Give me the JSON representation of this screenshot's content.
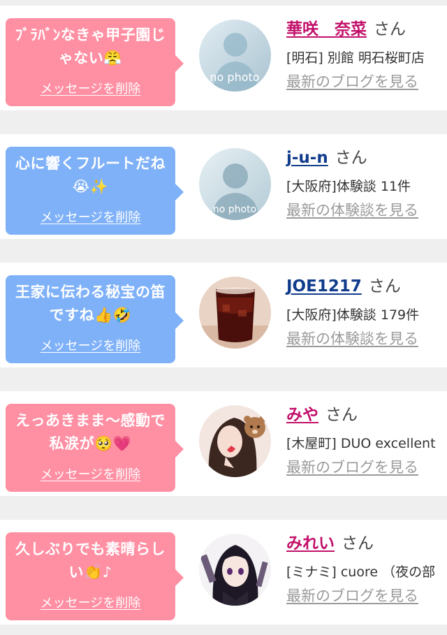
{
  "messages": [
    {
      "text": "ﾌﾞﾗﾊﾞﾝなきゃ甲子園じゃない😤",
      "delete_label": "メッセージを削除",
      "bubble_color": "#ff8fa3",
      "avatar": "no-photo-placeholder",
      "avatar_text": "no photo",
      "user_name": "華咲　奈菜",
      "name_color": "#c2106a",
      "honorific": "さん",
      "meta": "[明石] 別館 明石桜町店",
      "link_label": "最新のブログを見る"
    },
    {
      "text": "心に響くフルートだね😭✨",
      "delete_label": "メッセージを削除",
      "bubble_color": "#7fb1f8",
      "avatar": "no-photo-placeholder",
      "avatar_text": "no photo",
      "user_name": "j-u-n",
      "name_color": "#103c8c",
      "honorific": "さん",
      "meta": "[大阪府]体験談 11件",
      "link_label": "最新の体験談を見る"
    },
    {
      "text": "王家に伝わる秘宝の笛ですね👍🤣",
      "delete_label": "メッセージを削除",
      "bubble_color": "#7fb1f8",
      "avatar": "drink-glass-photo",
      "user_name": "JOE1217",
      "name_color": "#103c8c",
      "honorific": "さん",
      "meta": "[大阪府]体験談 179件",
      "link_label": "最新の体験談を見る"
    },
    {
      "text": "えっあきまま〜感動で私涙が🥺💗",
      "delete_label": "メッセージを削除",
      "bubble_color": "#ff8fa3",
      "avatar": "woman-selfie-photo",
      "user_name": "みや",
      "name_color": "#c2106a",
      "honorific": "さん",
      "meta": "[木屋町] DUO excellent",
      "link_label": "最新のブログを見る"
    },
    {
      "text": "久しぶりでも素晴らしい👏♪",
      "delete_label": "メッセージを削除",
      "bubble_color": "#ff8fa3",
      "avatar": "anime-character-photo",
      "user_name": "みれい",
      "name_color": "#c2106a",
      "honorific": "さん",
      "meta": "[ミナミ] cuore （夜の部",
      "link_label": "最新のブログを見る"
    }
  ]
}
